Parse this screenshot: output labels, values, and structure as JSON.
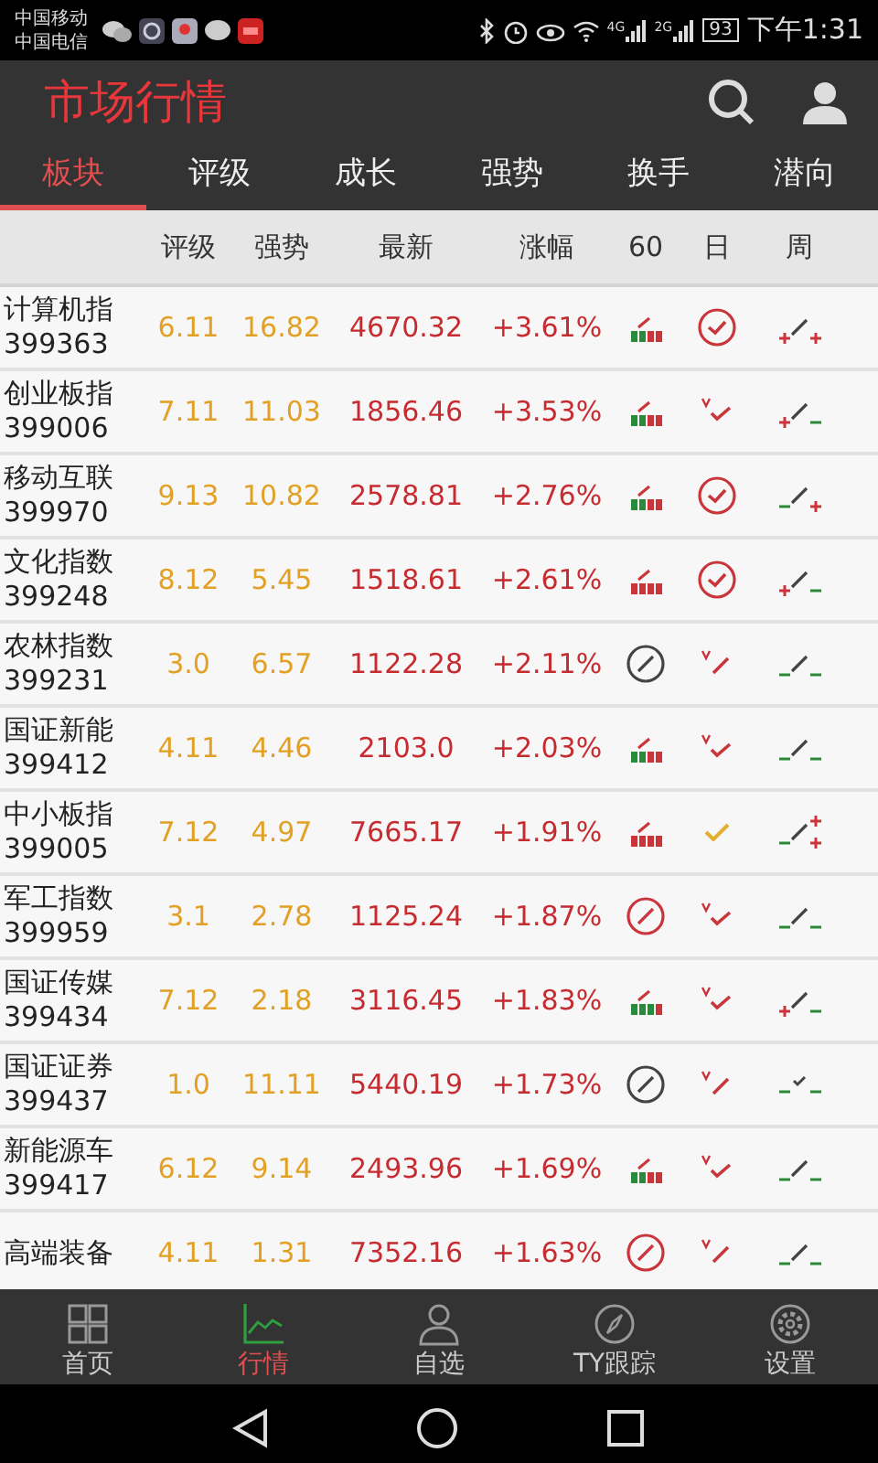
{
  "status_bar": {
    "carriers": [
      "中国移动",
      "中国电信"
    ],
    "network_1": "4G",
    "network_2": "2G",
    "battery": "93",
    "time": "下午1:31"
  },
  "header": {
    "title": "市场行情"
  },
  "tabs": [
    {
      "label": "板块",
      "selected": true
    },
    {
      "label": "评级",
      "selected": false
    },
    {
      "label": "成长",
      "selected": false
    },
    {
      "label": "强势",
      "selected": false
    },
    {
      "label": "换手",
      "selected": false
    },
    {
      "label": "潜向",
      "selected": false
    }
  ],
  "table": {
    "columns": [
      "评级",
      "强势",
      "最新",
      "涨幅",
      "60",
      "日",
      "周"
    ],
    "rows": [
      {
        "name": "计算机指",
        "code": "399363",
        "rating": "6.11",
        "strength": "16.82",
        "latest": "4670.32",
        "change": "+3.61%",
        "s60": {
          "kind": "bars-mixed"
        },
        "day": {
          "kind": "circle-check"
        },
        "week": {
          "kind": "plus-plus"
        }
      },
      {
        "name": "创业板指",
        "code": "399006",
        "rating": "7.11",
        "strength": "11.03",
        "latest": "1856.46",
        "change": "+3.53%",
        "s60": {
          "kind": "bars-mixed"
        },
        "day": {
          "kind": "v-check"
        },
        "week": {
          "kind": "plus-minus"
        }
      },
      {
        "name": "移动互联",
        "code": "399970",
        "rating": "9.13",
        "strength": "10.82",
        "latest": "2578.81",
        "change": "+2.76%",
        "s60": {
          "kind": "bars-mixed"
        },
        "day": {
          "kind": "circle-check"
        },
        "week": {
          "kind": "minus-plus"
        }
      },
      {
        "name": "文化指数",
        "code": "399248",
        "rating": "8.12",
        "strength": "5.45",
        "latest": "1518.61",
        "change": "+2.61%",
        "s60": {
          "kind": "bars-red"
        },
        "day": {
          "kind": "circle-check"
        },
        "week": {
          "kind": "plus-minus"
        }
      },
      {
        "name": "农林指数",
        "code": "399231",
        "rating": "3.0",
        "strength": "6.57",
        "latest": "1122.28",
        "change": "+2.11%",
        "s60": {
          "kind": "no-grey"
        },
        "day": {
          "kind": "v-slash"
        },
        "week": {
          "kind": "minus-minus"
        }
      },
      {
        "name": "国证新能",
        "code": "399412",
        "rating": "4.11",
        "strength": "4.46",
        "latest": "2103.0",
        "change": "+2.03%",
        "s60": {
          "kind": "bars-mixed"
        },
        "day": {
          "kind": "v-check"
        },
        "week": {
          "kind": "minus-minus"
        }
      },
      {
        "name": "中小板指",
        "code": "399005",
        "rating": "7.12",
        "strength": "4.97",
        "latest": "7665.17",
        "change": "+1.91%",
        "s60": {
          "kind": "bars-red"
        },
        "day": {
          "kind": "check"
        },
        "week": {
          "kind": "minus-double-plus"
        }
      },
      {
        "name": "军工指数",
        "code": "399959",
        "rating": "3.1",
        "strength": "2.78",
        "latest": "1125.24",
        "change": "+1.87%",
        "s60": {
          "kind": "no-red"
        },
        "day": {
          "kind": "v-check"
        },
        "week": {
          "kind": "minus-minus"
        }
      },
      {
        "name": "国证传媒",
        "code": "399434",
        "rating": "7.12",
        "strength": "2.18",
        "latest": "3116.45",
        "change": "+1.83%",
        "s60": {
          "kind": "bars-green"
        },
        "day": {
          "kind": "v-check"
        },
        "week": {
          "kind": "plus-minus"
        }
      },
      {
        "name": "国证证券",
        "code": "399437",
        "rating": "1.0",
        "strength": "11.11",
        "latest": "5440.19",
        "change": "+1.73%",
        "s60": {
          "kind": "no-grey"
        },
        "day": {
          "kind": "v-slash"
        },
        "week": {
          "kind": "minus-check-minus"
        }
      },
      {
        "name": "新能源车",
        "code": "399417",
        "rating": "6.12",
        "strength": "9.14",
        "latest": "2493.96",
        "change": "+1.69%",
        "s60": {
          "kind": "bars-mixed"
        },
        "day": {
          "kind": "v-check"
        },
        "week": {
          "kind": "minus-minus"
        }
      },
      {
        "name": "高端装备",
        "rating": "4.11",
        "strength": "1.31",
        "latest": "7352.16",
        "change": "+1.63%",
        "s60": {
          "kind": "no-red"
        },
        "day": {
          "kind": "v-slash"
        },
        "week": {
          "kind": "minus-minus"
        }
      }
    ]
  },
  "bottom_nav": [
    {
      "label": "首页",
      "selected": false
    },
    {
      "label": "行情",
      "selected": true
    },
    {
      "label": "自选",
      "selected": false
    },
    {
      "label": "TY跟踪",
      "selected": false
    },
    {
      "label": "设置",
      "selected": false
    }
  ]
}
